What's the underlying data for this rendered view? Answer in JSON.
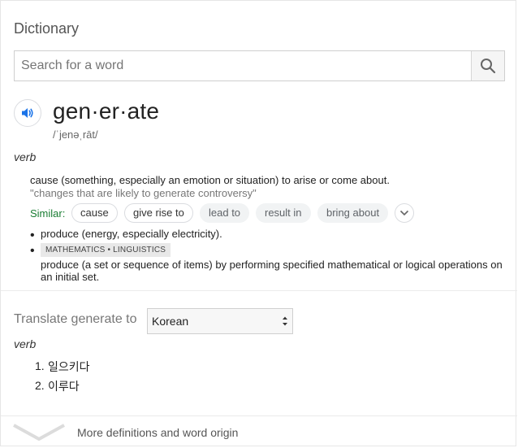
{
  "card": {
    "title": "Dictionary"
  },
  "search": {
    "placeholder": "Search for a word"
  },
  "entry": {
    "headword": "gen·er·ate",
    "phonetic": "/ˈjenəˌrāt/",
    "part_of_speech": "verb",
    "senses": [
      {
        "definition": "cause (something, especially an emotion or situation) to arise or come about.",
        "example": "\"changes that are likely to generate controversy\"",
        "similar_label": "Similar:",
        "similar": [
          "cause",
          "give rise to",
          "lead to",
          "result in",
          "bring about"
        ]
      },
      {
        "definition": "produce (energy, especially electricity)."
      },
      {
        "tag": "MATHEMATICS • LINGUISTICS",
        "definition_line1": "produce (a set or sequence of items) by performing specified mathematical or logical operations on",
        "definition_line2": "an initial set."
      }
    ]
  },
  "translate": {
    "label": "Translate generate to",
    "language": "Korean",
    "part_of_speech": "verb",
    "items": [
      {
        "number": "1.",
        "text": "일으키다"
      },
      {
        "number": "2.",
        "text": "이루다"
      }
    ]
  },
  "footer": {
    "more": "More definitions and word origin"
  },
  "colors": {
    "similar_label": "#1a7d33",
    "audio_icon": "#1a73e8"
  }
}
